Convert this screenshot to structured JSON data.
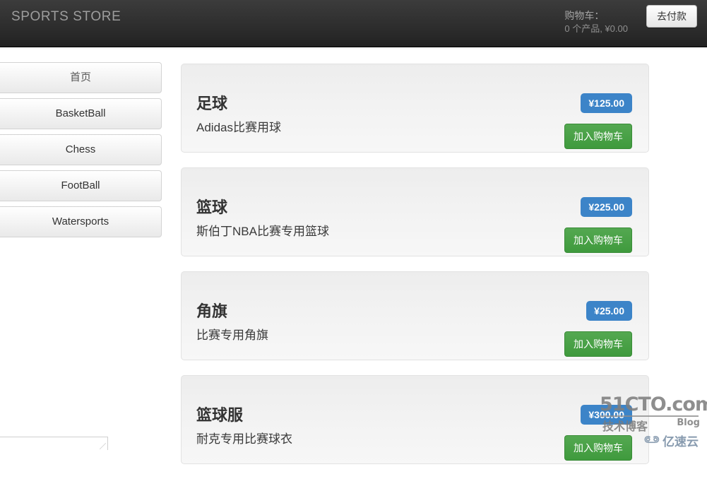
{
  "header": {
    "brand": "SPORTS STORE",
    "cart_label": "购物车：",
    "cart_summary": "0 个产品, ¥0.00",
    "checkout_label": "去付款"
  },
  "sidebar": {
    "items": [
      {
        "label": "首页"
      },
      {
        "label": "BasketBall"
      },
      {
        "label": "Chess"
      },
      {
        "label": "FootBall"
      },
      {
        "label": "Watersports"
      }
    ]
  },
  "products": [
    {
      "title": "足球",
      "description": "Adidas比赛用球",
      "price": "¥125.00",
      "add_label": "加入购物车"
    },
    {
      "title": "篮球",
      "description": "斯伯丁NBA比赛专用篮球",
      "price": "¥225.00",
      "add_label": "加入购物车"
    },
    {
      "title": "角旗",
      "description": "比赛专用角旗",
      "price": "¥25.00",
      "add_label": "加入购物车"
    },
    {
      "title": "篮球服",
      "description": "耐克专用比赛球衣",
      "price": "¥300.00",
      "add_label": "加入购物车"
    }
  ],
  "watermark": {
    "main": "51CTO.com",
    "sub": "技术博客",
    "blog": "Blog",
    "cloud_text": "亿速云"
  },
  "colors": {
    "navbar_dark": "#222222",
    "price_blue": "#3c84c8",
    "add_green": "#3f9a3d",
    "card_bg": "#ededed"
  }
}
